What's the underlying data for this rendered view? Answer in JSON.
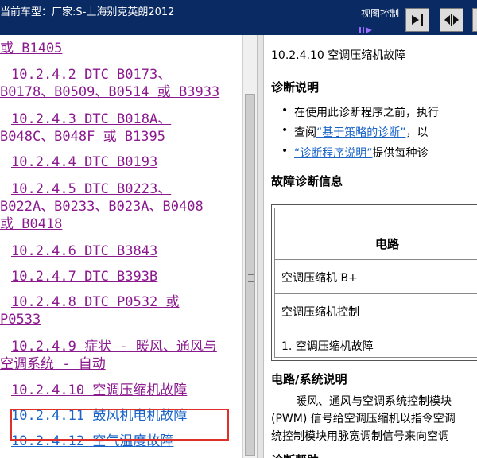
{
  "header": {
    "title": "当前车型：厂家:S-上海别克英朗2012",
    "view_control_label": "视图控制",
    "accent": "#0a2a63"
  },
  "nav": {
    "items": [
      {
        "lines": [
          "或 B1405"
        ],
        "state": "visited"
      },
      {
        "lines": [
          "10.2.4.2 DTC B0173、",
          "B0178、B0509、B0514 或 B3933"
        ],
        "state": "visited"
      },
      {
        "lines": [
          "10.2.4.3 DTC B018A、",
          "B048C、B048F 或 B1395"
        ],
        "state": "visited"
      },
      {
        "lines": [
          "10.2.4.4 DTC B0193"
        ],
        "state": "visited"
      },
      {
        "lines": [
          "10.2.4.5 DTC B0223、",
          "B022A、B0233、B023A、B0408",
          "或 B0418"
        ],
        "state": "visited"
      },
      {
        "lines": [
          "10.2.4.6 DTC B3843"
        ],
        "state": "visited"
      },
      {
        "lines": [
          "10.2.4.7 DTC B393B"
        ],
        "state": "visited"
      },
      {
        "lines": [
          "10.2.4.8 DTC P0532 或",
          "P0533"
        ],
        "state": "visited"
      },
      {
        "lines": [
          "10.2.4.9 症状 - 暖风、通风与",
          "空调系统 - 自动"
        ],
        "state": "visited"
      },
      {
        "lines": [
          "10.2.4.10 空调压缩机故障"
        ],
        "state": "current"
      },
      {
        "lines": [
          "10.2.4.11 鼓风机电机故障"
        ],
        "state": "link"
      },
      {
        "lines": [
          "10.2.4.12 空气温度故障"
        ],
        "state": "link"
      }
    ]
  },
  "content": {
    "title": "10.2.4.10 空调压缩机故障",
    "diag_heading": "诊断说明",
    "bullet1": "在使用此诊断程序之前，执行",
    "bullet2_prefix": "查阅",
    "bullet2_link": "“基于策略的诊断”",
    "bullet2_suffix": "，以",
    "bullet3_link": "“诊断程序说明”",
    "bullet3_suffix": "提供每种诊",
    "fault_heading": "故障诊断信息",
    "table": {
      "header": "电路",
      "rows": [
        "空调压缩机 B+",
        "空调压缩机控制",
        "1. 空调压缩机故障"
      ]
    },
    "circuit_heading": "电路/系统说明",
    "para": [
      "暖风、通风与空调系统控制模块",
      "(PWM) 信号给空调压缩机以指令空调",
      "统控制模块用脉宽调制信号来向空调"
    ],
    "next_heading": "诊断帮助"
  },
  "colors": {
    "visited_link": "#8b1a8f",
    "link": "#1a64c8",
    "current_highlight": "#e0302a"
  }
}
